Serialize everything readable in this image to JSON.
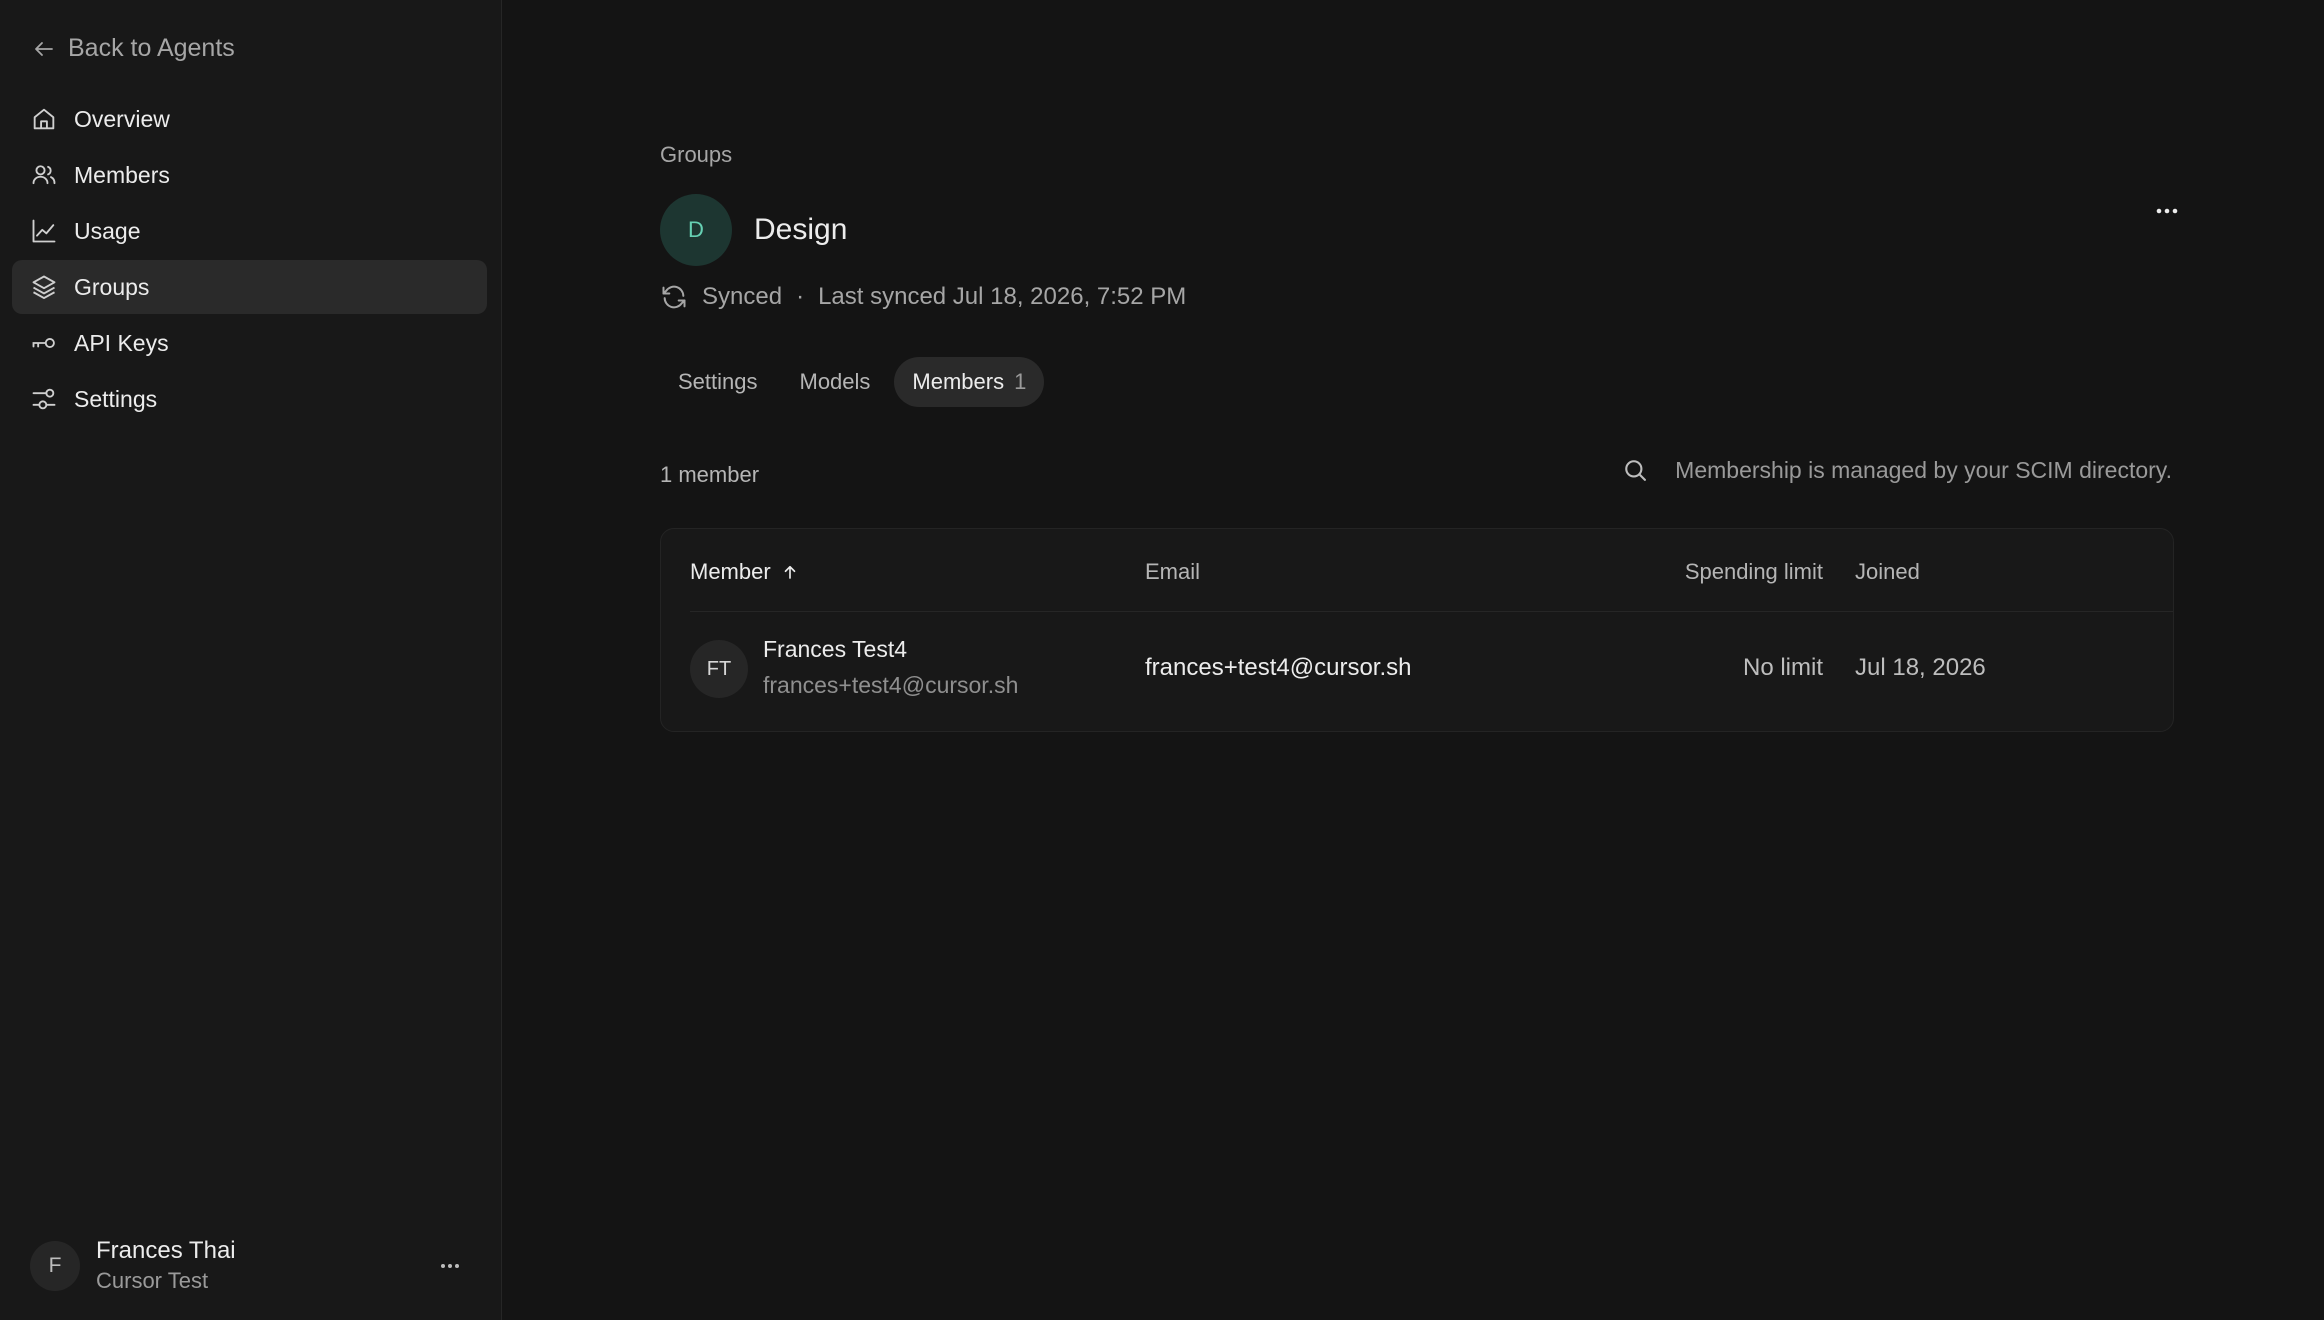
{
  "sidebar": {
    "back_label": "Back to Agents",
    "items": [
      {
        "label": "Overview",
        "icon": "home-icon"
      },
      {
        "label": "Members",
        "icon": "users-icon"
      },
      {
        "label": "Usage",
        "icon": "chart-icon"
      },
      {
        "label": "Groups",
        "icon": "layers-icon",
        "active": true
      },
      {
        "label": "API Keys",
        "icon": "key-icon"
      },
      {
        "label": "Settings",
        "icon": "sliders-icon"
      }
    ],
    "user": {
      "initial": "F",
      "name": "Frances Thai",
      "org": "Cursor Test"
    }
  },
  "main": {
    "breadcrumb": "Groups",
    "group": {
      "initial": "D",
      "name": "Design",
      "avatar_bg": "#1d3631",
      "avatar_fg": "#66d0b3"
    },
    "sync": {
      "status": "Synced",
      "separator": "·",
      "last_synced": "Last synced Jul 18, 2026, 7:52 PM"
    },
    "tabs": [
      {
        "label": "Settings"
      },
      {
        "label": "Models"
      },
      {
        "label": "Members",
        "count": "1",
        "active": true
      }
    ],
    "member_count": "1 member",
    "search_note": "Membership is managed by your SCIM directory.",
    "table": {
      "columns": {
        "member": "Member",
        "email": "Email",
        "spending_limit": "Spending limit",
        "joined": "Joined"
      },
      "rows": [
        {
          "initials": "FT",
          "name": "Frances Test4",
          "sub_email": "frances+test4@cursor.sh",
          "email": "frances+test4@cursor.sh",
          "spending_limit": "No limit",
          "joined": "Jul 18, 2026"
        }
      ]
    }
  },
  "colors": {
    "background": "#141414",
    "sidebar": "#181818",
    "active_item": "#2a2a2a",
    "accent": "#66d0b3"
  }
}
